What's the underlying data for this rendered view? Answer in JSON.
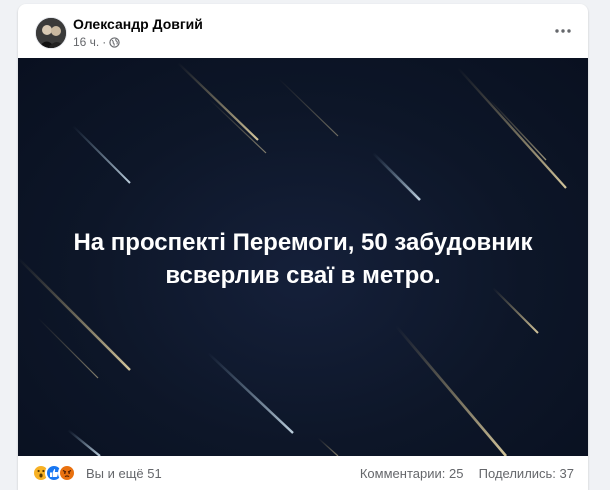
{
  "post": {
    "author": "Олександр Довгий",
    "time": "16 ч.",
    "separator": "·",
    "privacy_icon": "globe-icon",
    "more_icon": "more-horizontal-icon",
    "image_text_line1": "На проспекті Перемоги, 50 забудовник",
    "image_text_line2": "всверлив сваї в метро."
  },
  "footer": {
    "reaction_icons": [
      "wow-emoji",
      "like-thumb",
      "angry-emoji"
    ],
    "reactions_text": "Вы и ещё 51",
    "comments_text": "Комментарии: 25",
    "shares_text": "Поделились: 37"
  },
  "colors": {
    "like_blue": "#1877f2",
    "wow_yellow": "#f7b125",
    "angry_orange": "#e9710f",
    "image_background": "#0d1628"
  }
}
